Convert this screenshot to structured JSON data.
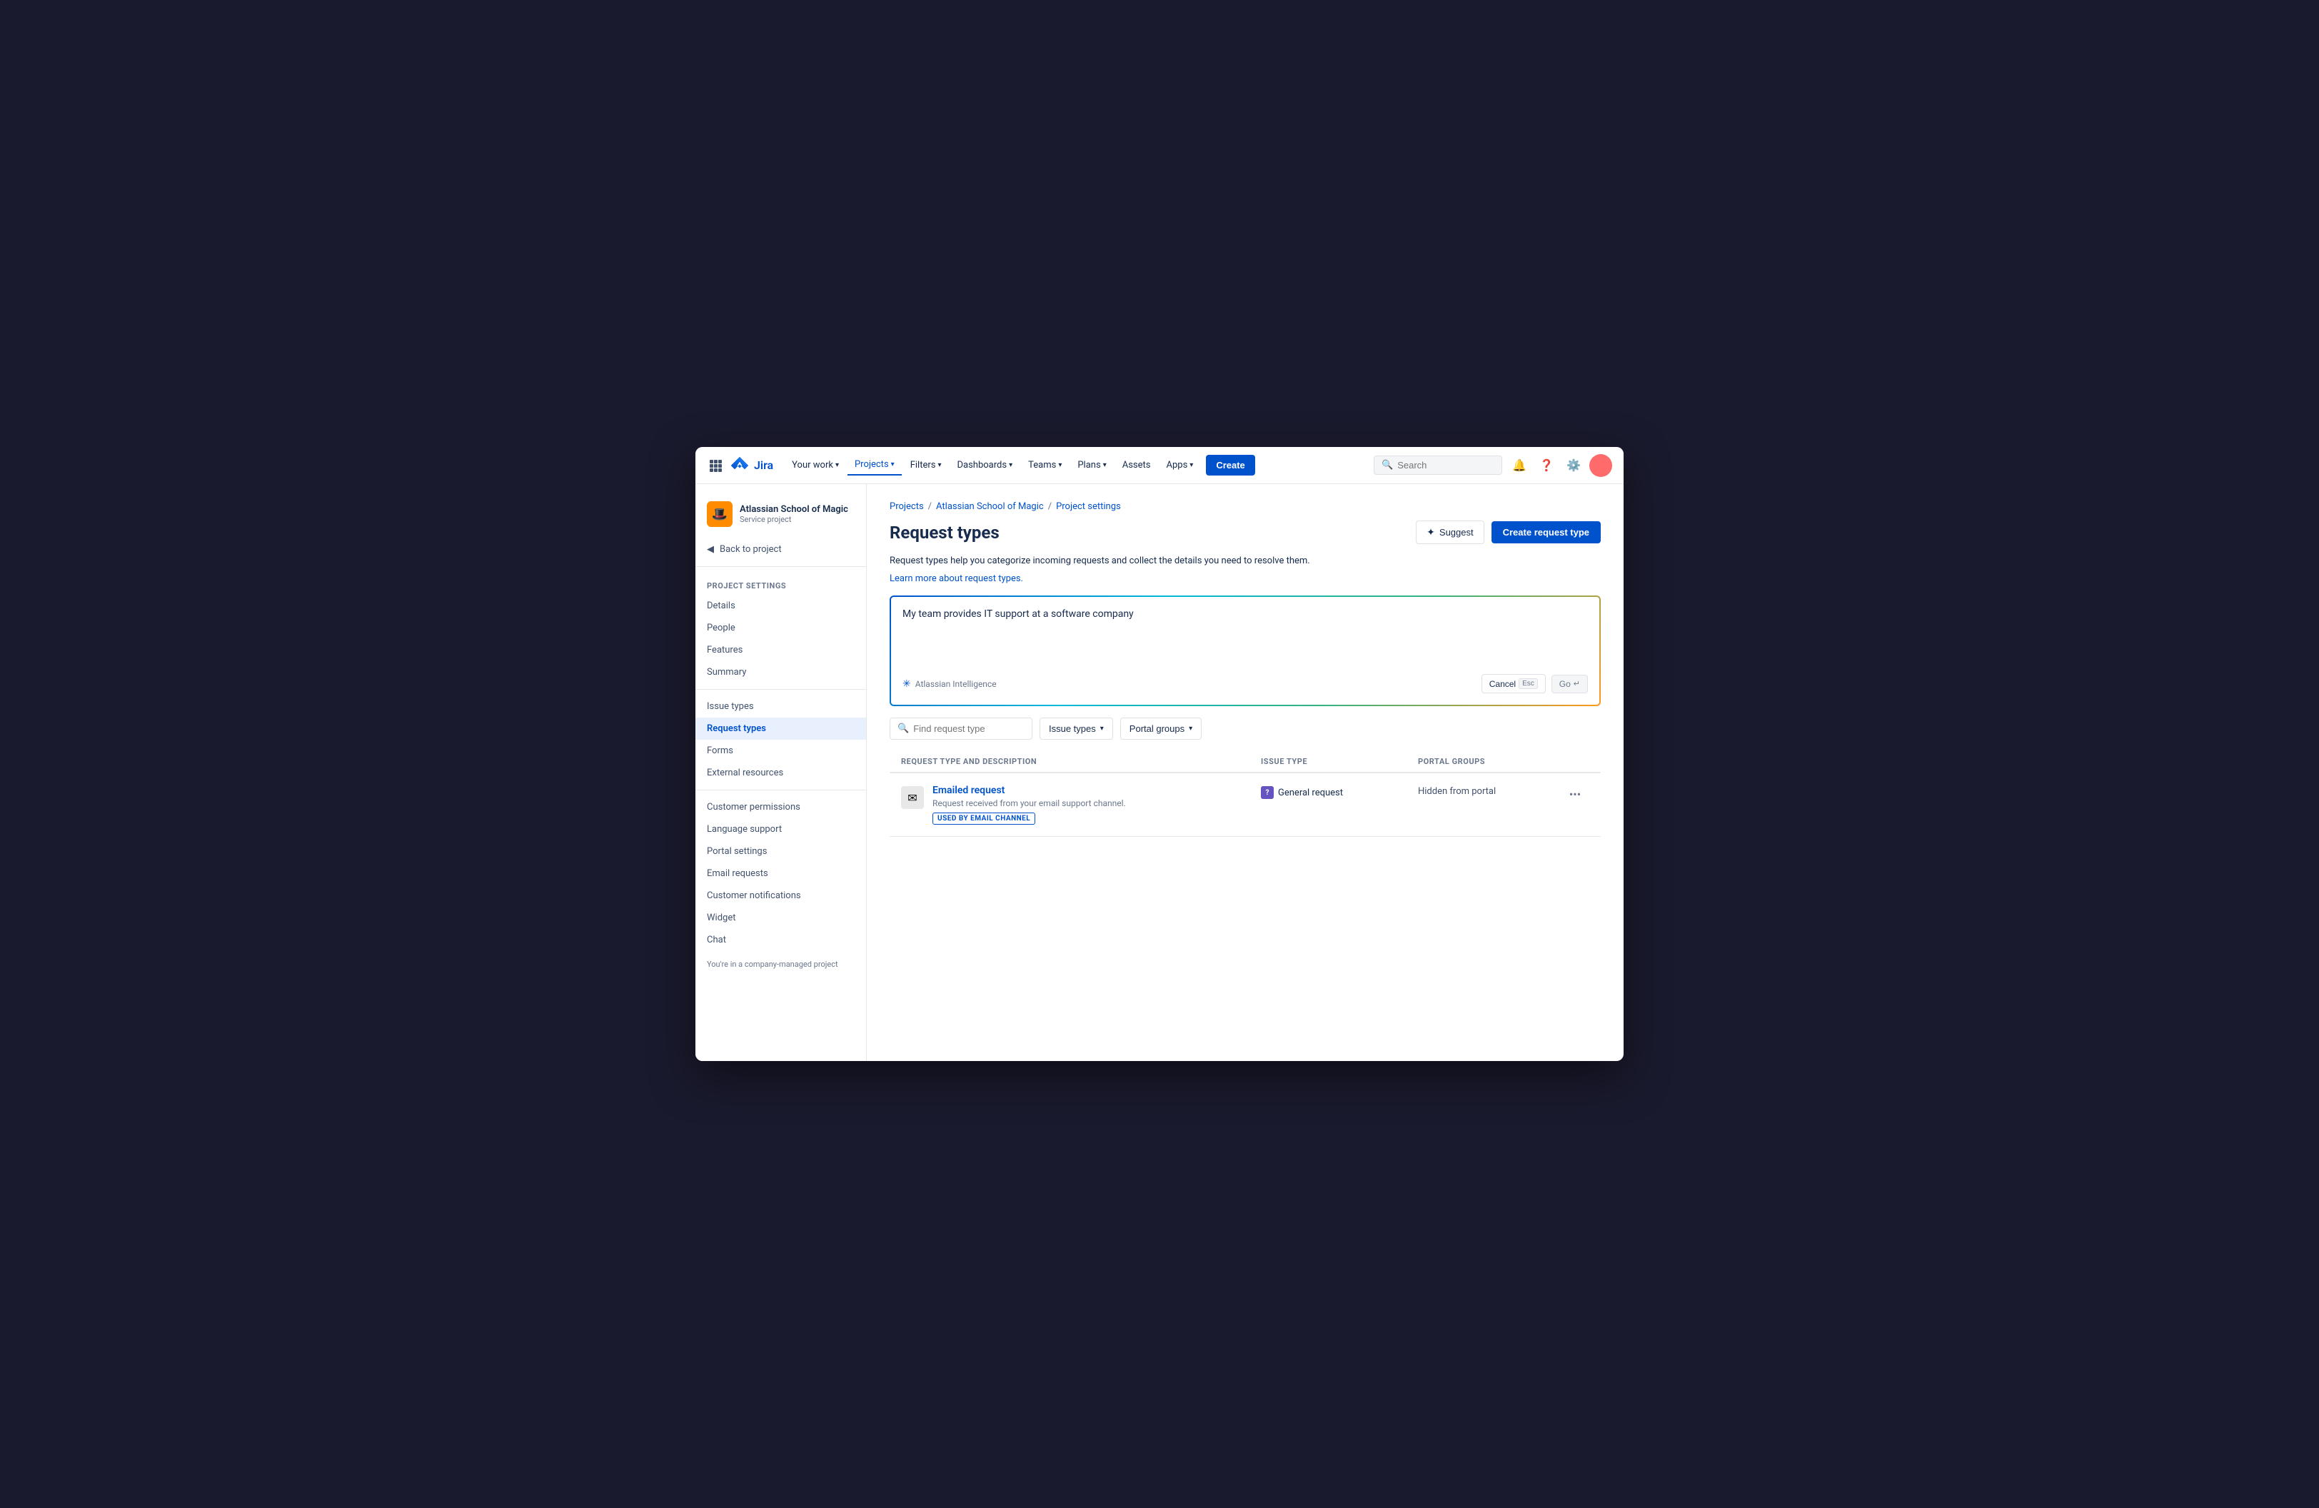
{
  "topnav": {
    "logo_text": "Jira",
    "nav_items": [
      {
        "label": "Your work",
        "id": "your-work",
        "has_dropdown": true
      },
      {
        "label": "Projects",
        "id": "projects",
        "has_dropdown": true,
        "active": true
      },
      {
        "label": "Filters",
        "id": "filters",
        "has_dropdown": true
      },
      {
        "label": "Dashboards",
        "id": "dashboards",
        "has_dropdown": true
      },
      {
        "label": "Teams",
        "id": "teams",
        "has_dropdown": true
      },
      {
        "label": "Plans",
        "id": "plans",
        "has_dropdown": true
      },
      {
        "label": "Assets",
        "id": "assets",
        "has_dropdown": false
      },
      {
        "label": "Apps",
        "id": "apps",
        "has_dropdown": true
      }
    ],
    "create_label": "Create",
    "search_placeholder": "Search"
  },
  "sidebar": {
    "project_name": "Atlassian School of Magic",
    "project_type": "Service project",
    "back_label": "Back to project",
    "section_header": "Project settings",
    "items": [
      {
        "label": "Details",
        "id": "details"
      },
      {
        "label": "People",
        "id": "people"
      },
      {
        "label": "Features",
        "id": "features"
      },
      {
        "label": "Summary",
        "id": "summary"
      },
      {
        "label": "Issue types",
        "id": "issue-types"
      },
      {
        "label": "Request types",
        "id": "request-types",
        "active": true
      },
      {
        "label": "Forms",
        "id": "forms"
      },
      {
        "label": "External resources",
        "id": "external-resources"
      },
      {
        "label": "Customer permissions",
        "id": "customer-permissions"
      },
      {
        "label": "Language support",
        "id": "language-support"
      },
      {
        "label": "Portal settings",
        "id": "portal-settings"
      },
      {
        "label": "Email requests",
        "id": "email-requests"
      },
      {
        "label": "Customer notifications",
        "id": "customer-notifications"
      },
      {
        "label": "Widget",
        "id": "widget"
      },
      {
        "label": "Chat",
        "id": "chat"
      }
    ],
    "footer_text": "You're in a company-managed project"
  },
  "breadcrumb": {
    "items": [
      {
        "label": "Projects",
        "href": "#"
      },
      {
        "label": "Atlassian School of Magic",
        "href": "#"
      },
      {
        "label": "Project settings",
        "href": "#"
      }
    ]
  },
  "page": {
    "title": "Request types",
    "description": "Request types help you categorize incoming requests and collect the details you need to resolve them.",
    "learn_more_text": "Learn more about request types.",
    "suggest_label": "Suggest",
    "create_label": "Create request type"
  },
  "ai_box": {
    "placeholder": "My team provides IT support at a software company",
    "content": "My team provides IT support at a software company",
    "ai_label": "Atlassian Intelligence",
    "cancel_label": "Cancel",
    "esc_label": "Esc",
    "go_label": "Go"
  },
  "filters": {
    "search_placeholder": "Find request type",
    "issue_types_label": "Issue types",
    "portal_groups_label": "Portal groups"
  },
  "table": {
    "columns": {
      "request_type": "Request type and description",
      "issue_type": "Issue type",
      "portal_groups": "Portal groups"
    },
    "rows": [
      {
        "icon": "✉",
        "name": "Emailed request",
        "description": "Request received from your email support channel.",
        "badge": "USED BY EMAIL CHANNEL",
        "issue_type_icon": "?",
        "issue_type": "General request",
        "portal_groups": "Hidden from portal"
      }
    ]
  }
}
